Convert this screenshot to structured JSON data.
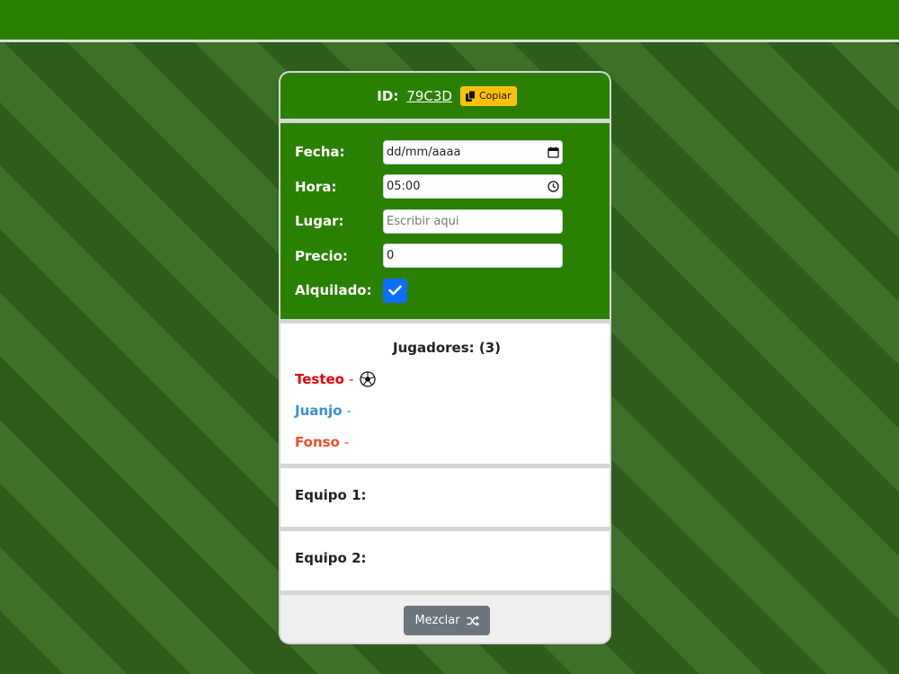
{
  "header": {
    "id_label": "ID:",
    "id_value": "79C3D",
    "copy_label": "Copiar"
  },
  "form": {
    "fecha_label": "Fecha:",
    "fecha_value": "dd/mm/aaaa",
    "hora_label": "Hora:",
    "hora_value": "05:00",
    "lugar_label": "Lugar:",
    "lugar_placeholder": "Escribir aqui",
    "precio_label": "Precio:",
    "precio_value": "0",
    "alquilado_label": "Alquilado:",
    "alquilado_checked": true
  },
  "players": {
    "title": "Jugadores: (3)",
    "list": [
      {
        "name": "Testeo",
        "dash": "-",
        "color": "#e8000b",
        "icon": "soccer-ball-icon"
      },
      {
        "name": "Juanjo",
        "dash": "-",
        "color": "#3a8fd6",
        "icon": null
      },
      {
        "name": "Fonso",
        "dash": "-",
        "color": "#f04d2f",
        "icon": null
      }
    ]
  },
  "teams": {
    "team1_label": "Equipo 1:",
    "team2_label": "Equipo 2:"
  },
  "footer": {
    "mix_label": "Mezclar",
    "mix_icon": "shuffle-icon"
  },
  "colors": {
    "header_green": "#2a8000",
    "copy_yellow": "#ffc107",
    "checkbox_blue": "#0d6efd",
    "mix_gray": "#6c757d"
  }
}
